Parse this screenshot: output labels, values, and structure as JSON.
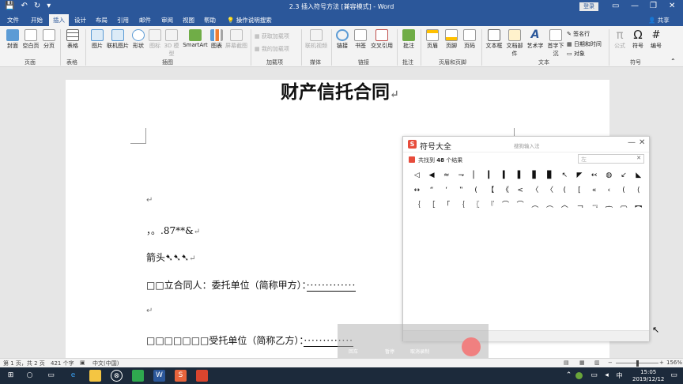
{
  "window": {
    "title": "2.3 插入符号方法 [兼容模式] - Word",
    "login_label": "登录",
    "share_label": "共享"
  },
  "tabs": [
    "文件",
    "开始",
    "插入",
    "设计",
    "布局",
    "引用",
    "邮件",
    "审阅",
    "视图",
    "帮助",
    "操作说明搜索"
  ],
  "active_tab": "插入",
  "ribbon": {
    "buttons": [
      {
        "label": "封面",
        "icon": "cover-page-icon",
        "disabled": false
      },
      {
        "label": "空白页",
        "icon": "blank-page-icon",
        "disabled": false
      },
      {
        "label": "分页",
        "icon": "page-break-icon",
        "disabled": false
      },
      {
        "label": "表格",
        "icon": "table-icon",
        "disabled": false
      },
      {
        "label": "图片",
        "icon": "picture-icon",
        "disabled": false
      },
      {
        "label": "联机图片",
        "icon": "online-picture-icon",
        "disabled": false
      },
      {
        "label": "形状",
        "icon": "shapes-icon",
        "disabled": false
      },
      {
        "label": "图标",
        "icon": "icons-icon",
        "disabled": true
      },
      {
        "label": "3D 模型",
        "icon": "3d-model-icon",
        "disabled": true
      },
      {
        "label": "SmartArt",
        "icon": "smartart-icon",
        "disabled": false
      },
      {
        "label": "图表",
        "icon": "chart-icon",
        "disabled": false
      },
      {
        "label": "屏幕截图",
        "icon": "screenshot-icon",
        "disabled": true
      },
      {
        "label": "联机视频",
        "icon": "online-video-icon",
        "disabled": true
      },
      {
        "label": "链接",
        "icon": "link-icon",
        "disabled": false
      },
      {
        "label": "书签",
        "icon": "bookmark-icon",
        "disabled": false
      },
      {
        "label": "交叉引用",
        "icon": "cross-reference-icon",
        "disabled": false
      },
      {
        "label": "批注",
        "icon": "comment-icon",
        "disabled": false
      },
      {
        "label": "页眉",
        "icon": "header-icon",
        "disabled": false
      },
      {
        "label": "页脚",
        "icon": "footer-icon",
        "disabled": false
      },
      {
        "label": "页码",
        "icon": "page-number-icon",
        "disabled": false
      },
      {
        "label": "文本框",
        "icon": "text-box-icon",
        "disabled": false
      },
      {
        "label": "文档部件",
        "icon": "quick-parts-icon",
        "disabled": false
      },
      {
        "label": "艺术字",
        "icon": "wordart-icon",
        "disabled": false
      },
      {
        "label": "首字下沉",
        "icon": "drop-cap-icon",
        "disabled": false
      },
      {
        "label": "公式",
        "icon": "equation-icon",
        "disabled": true
      },
      {
        "label": "符号",
        "icon": "omega-symbol-icon",
        "disabled": false
      },
      {
        "label": "编号",
        "icon": "number-icon",
        "disabled": false
      }
    ],
    "small_buttons": {
      "get_addins": "获取加载项",
      "my_addins": "我的加载项",
      "signature_line": "签名行",
      "date_time": "日期和时间",
      "object": "对象"
    },
    "groups": [
      "页面",
      "表格",
      "插图",
      "加载项",
      "媒体",
      "链接",
      "批注",
      "页眉和页脚",
      "文本",
      "符号"
    ]
  },
  "document": {
    "title": "财产信托合同",
    "lines": [
      "，。.87**&",
      "箭头➷➷➷",
      "□□立合同人：委托单位（简称甲方）：",
      "□□□□□□□受托单位（简称乙方）："
    ],
    "return_mark": "↵",
    "underline_dots": "·············"
  },
  "symbol_panel": {
    "title": "符号大全",
    "subtitle": "搜狗输入法",
    "result_prefix": "共找到",
    "result_count": "48",
    "result_suffix": "个结果",
    "search_value": "左",
    "symbols": [
      "◁",
      "◀",
      "≈",
      "⇁",
      "▏",
      "▎",
      "▍",
      "▌",
      "▋",
      "▊",
      "↖",
      "◤",
      "↢",
      "◍",
      "↙",
      "◣",
      "↔",
      "“",
      "‘",
      "‟",
      "(",
      "【",
      "《",
      "<",
      "〈",
      "〈",
      "(",
      "[",
      "«",
      "‹",
      "(",
      "⟨",
      "｛",
      "［",
      "「",
      "｛",
      "〖",
      "『",
      "⌒",
      "⌒",
      "︵",
      "︵",
      "︿",
      "﹁",
      "﹃",
      "︷",
      "︹",
      "︻"
    ]
  },
  "recording_overlay": {
    "labels": [
      "回车",
      "暂停",
      "取消录制"
    ]
  },
  "statusbar": {
    "page_info": "第 1 页，共 2 页",
    "word_count": "421 个字",
    "language": "中文(中国)",
    "zoom": "156%"
  },
  "taskbar": {
    "time": "15:05",
    "date": "2019/12/12"
  }
}
